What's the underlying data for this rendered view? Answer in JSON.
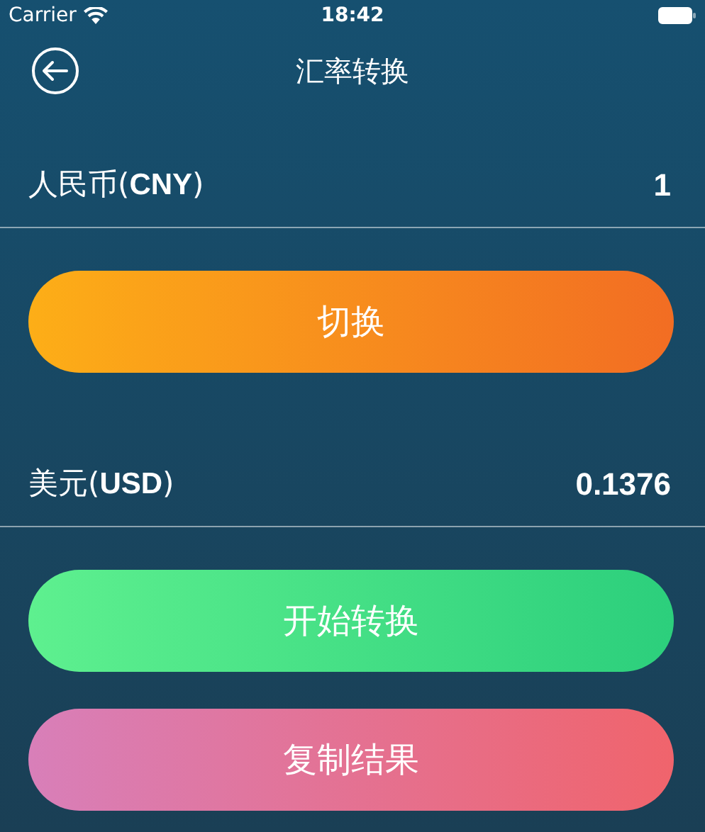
{
  "status_bar": {
    "carrier": "Carrier",
    "time": "18:42"
  },
  "nav": {
    "title": "汇率转换"
  },
  "content": [
    {
      "kind": "currency",
      "label": "人民币(**CNY**)",
      "value": "1"
    },
    {
      "kind": "button",
      "label": "切换"
    },
    {
      "kind": "currency",
      "label": "美元(**USD**)",
      "value": "0.1376"
    },
    {
      "kind": "button",
      "label": "开始转换"
    },
    {
      "kind": "button",
      "label": "复制结果"
    }
  ]
}
